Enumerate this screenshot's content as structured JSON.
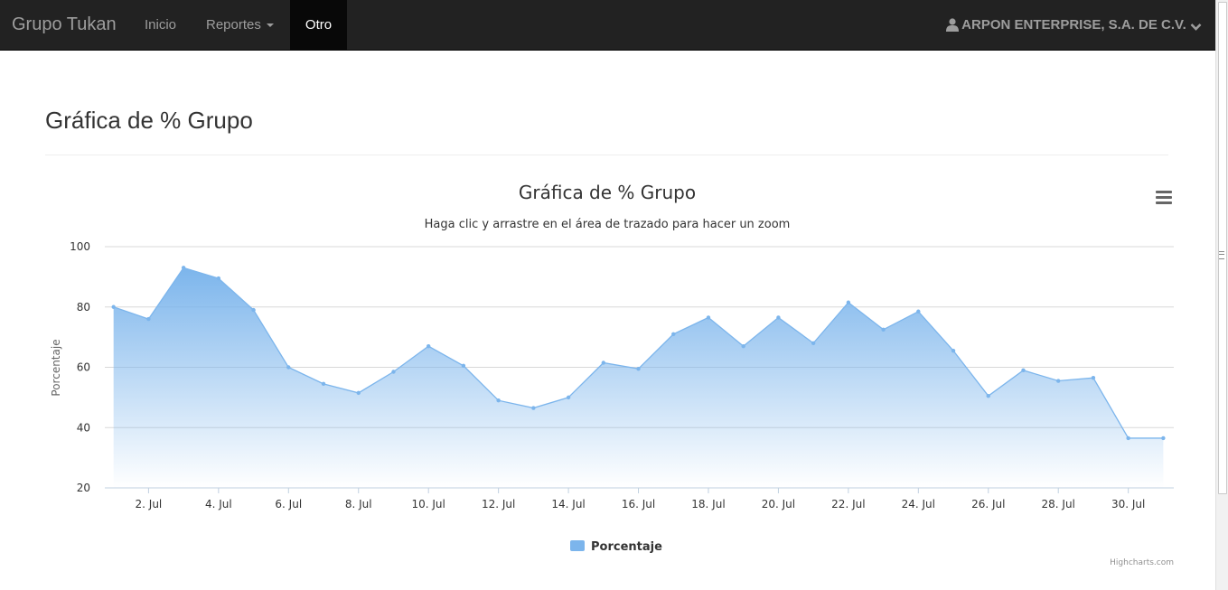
{
  "navbar": {
    "brand": "Grupo Tukan",
    "items": [
      {
        "label": "Inicio"
      },
      {
        "label": "Reportes"
      },
      {
        "label": "Otro"
      }
    ],
    "user_label": "ARPON ENTERPRISE, S.A. DE C.V.",
    "icons": {
      "user": "user-icon",
      "dropdown": "chevron-down-icon",
      "caret": "caret-down-icon"
    }
  },
  "page": {
    "title": "Gráfica de % Grupo"
  },
  "chart_menu_icon": "hamburger-menu-icon",
  "chart_data": {
    "type": "area",
    "title": "Gráfica de % Grupo",
    "subtitle": "Haga clic y arrastre en el área de trazado para hacer un zoom",
    "ylabel": "Porcentaje",
    "xlabel": "",
    "ylim": [
      20,
      100
    ],
    "yticks": [
      20,
      40,
      60,
      80,
      100
    ],
    "x_tick_labels": [
      "2. Jul",
      "4. Jul",
      "6. Jul",
      "8. Jul",
      "10. Jul",
      "12. Jul",
      "14. Jul",
      "16. Jul",
      "18. Jul",
      "20. Jul",
      "22. Jul",
      "24. Jul",
      "26. Jul",
      "28. Jul",
      "30. Jul"
    ],
    "x_tick_days": [
      2,
      4,
      6,
      8,
      10,
      12,
      14,
      16,
      18,
      20,
      22,
      24,
      26,
      28,
      30
    ],
    "xlim": [
      0.75,
      31.3
    ],
    "grid": true,
    "legend_position": "bottom-center",
    "credits": "Highcharts.com",
    "color": "#7cb5ec",
    "series": [
      {
        "name": "Porcentaje",
        "x": [
          1,
          2,
          3,
          4,
          5,
          6,
          7,
          8,
          9,
          10,
          11,
          12,
          13,
          14,
          15,
          16,
          17,
          18,
          19,
          20,
          21,
          22,
          23,
          24,
          25,
          26,
          27,
          28,
          29,
          30,
          31
        ],
        "values": [
          80,
          76,
          93,
          89.5,
          79,
          60,
          54.5,
          51.5,
          58.5,
          67,
          60.5,
          49,
          46.5,
          50,
          61.5,
          59.5,
          71,
          76.5,
          67,
          76.5,
          68,
          81.5,
          72.5,
          78.5,
          65.5,
          50.5,
          59,
          55.5,
          56.5,
          36.5,
          36.5
        ]
      }
    ]
  }
}
